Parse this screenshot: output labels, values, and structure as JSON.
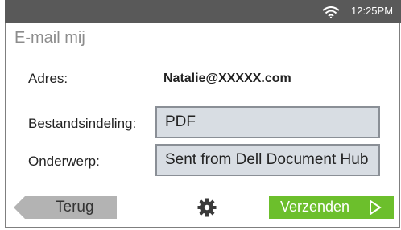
{
  "status_bar": {
    "wifi_icon": "wifi-icon",
    "time": "12:25PM"
  },
  "page": {
    "title": "E-mail mij"
  },
  "fields": {
    "address_label": "Adres:",
    "address_value": "Natalie@XXXXX.com",
    "format_label": "Bestandsindeling:",
    "format_value": "PDF",
    "subject_label": "Onderwerp:",
    "subject_value": "Sent from Dell Document Hub"
  },
  "footer": {
    "back_label": "Terug",
    "settings_icon": "gear-icon",
    "send_label": "Verzenden",
    "send_icon": "play-arrow-icon"
  },
  "colors": {
    "status_bar": "#595959",
    "send_button": "#6cbf2c",
    "back_button": "#b3b3b3",
    "field_box": "#d8dde3"
  }
}
